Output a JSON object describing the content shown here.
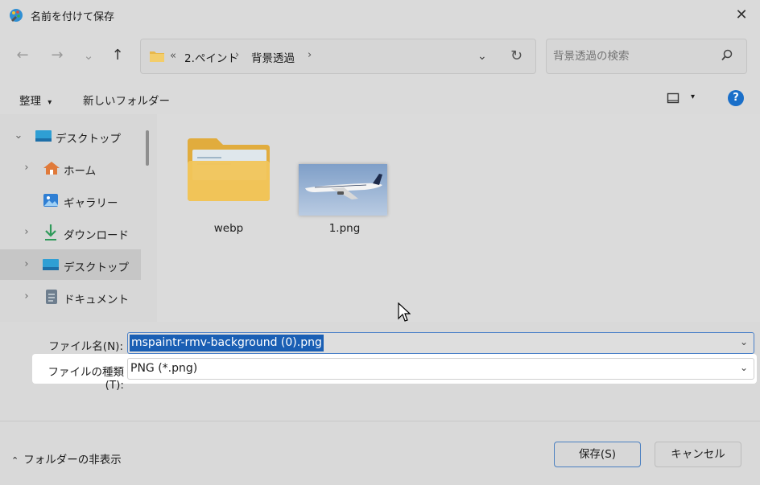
{
  "window": {
    "title": "名前を付けて保存",
    "close_label": "✕"
  },
  "navigation": {
    "back": "←",
    "forward": "→",
    "recent": "⌄",
    "up": "↑",
    "breadcrumb_overflow": "«",
    "breadcrumb": [
      "2.ペイント",
      "背景透過"
    ],
    "refresh": "↻"
  },
  "search": {
    "placeholder": "背景透過の検索"
  },
  "toolbar": {
    "organize_label": "整理",
    "new_folder_label": "新しいフォルダー",
    "help_label": "?"
  },
  "sidebar": {
    "items": [
      {
        "label": "デスクトップ",
        "expanded": true
      },
      {
        "label": "ホーム"
      },
      {
        "label": "ギャラリー"
      },
      {
        "label": "ダウンロード"
      },
      {
        "label": "デスクトップ",
        "selected": true
      },
      {
        "label": "ドキュメント"
      }
    ]
  },
  "files": [
    {
      "name": "webp",
      "kind": "folder"
    },
    {
      "name": "1.png",
      "kind": "image"
    }
  ],
  "form": {
    "filename_label": "ファイル名(N):",
    "filename_value": "mspaintr-rmv-background (0).png",
    "filetype_label": "ファイルの種類(T):",
    "filetype_value": "PNG (*.png)"
  },
  "footer": {
    "hide_folders_label": "フォルダーの非表示",
    "save_label": "保存(S)",
    "cancel_label": "キャンセル"
  },
  "colors": {
    "accent": "#1a5fb4",
    "folder": "#e8b84a",
    "help": "#1a6fc9"
  }
}
